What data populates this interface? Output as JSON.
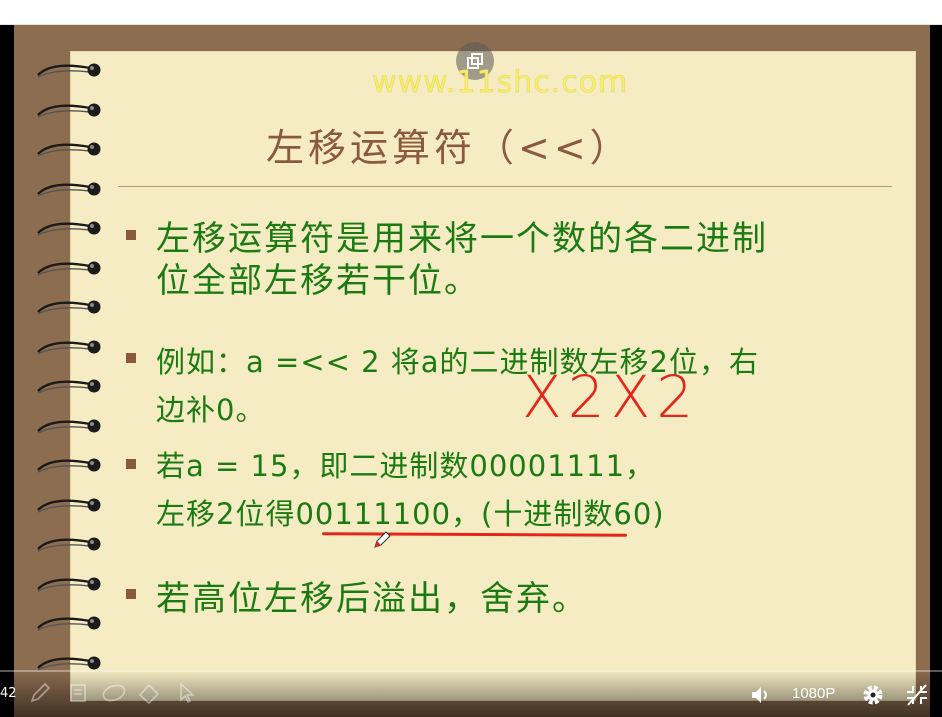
{
  "slide": {
    "watermark": "www.11shc.com",
    "title": "左移运算符（<<）",
    "bullets": [
      {
        "lines": [
          "左移运算符是用来将一个数的各二进制",
          "位全部左移若干位。"
        ]
      },
      {
        "lines": [
          "例如：a =<< 2  将a的二进制数左移2位，右",
          "边补0。"
        ]
      },
      {
        "lines": [
          "若a = 15，即二进制数00001111，",
          "左移2位得00111100，(十进制数60)"
        ]
      },
      {
        "lines": [
          "若高位左移后溢出，舍弃。"
        ]
      }
    ],
    "annotation": "X2X2"
  },
  "player": {
    "time": "42",
    "quality": "1080P"
  },
  "icons": {
    "popout": "popout-icon",
    "pen": "pen-icon",
    "highlighter": "highlighter-icon",
    "eraser": "eraser-icon",
    "pointer": "pointer-icon",
    "volume": "volume-icon",
    "settings": "gear-icon",
    "fullscreen-exit": "fullscreen-exit-icon"
  },
  "colors": {
    "board": "#8d6d50",
    "paper": "#f6ecc4",
    "title": "#8a5a3e",
    "body_text": "#1c7a13",
    "watermark": "#f4ee78",
    "annotation": "#e3261a"
  }
}
